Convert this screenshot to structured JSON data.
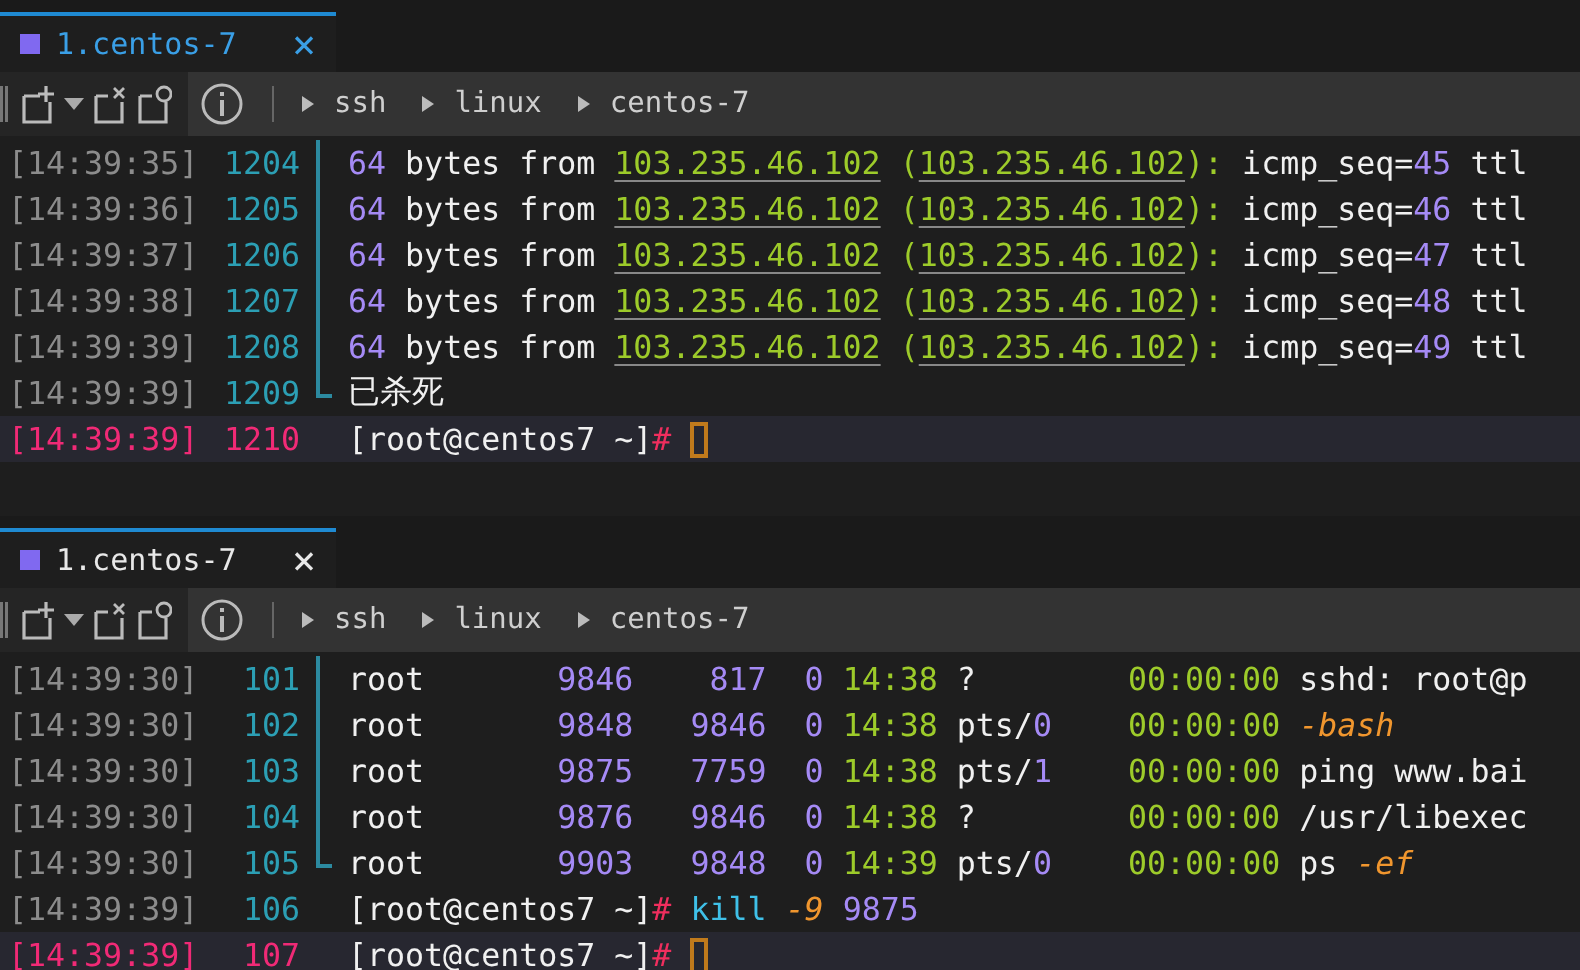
{
  "panes": [
    {
      "active": true,
      "tab": {
        "label": "1.centos-7",
        "close": "×"
      },
      "breadcrumbs": [
        "ssh",
        "linux",
        "centos-7"
      ],
      "lines": [
        {
          "time": "[14:39:35]",
          "number": "1204",
          "current": false,
          "fold_guide": true,
          "fold_end": false,
          "cursor": false,
          "segments": [
            {
              "kind": "number",
              "text": "64"
            },
            {
              "kind": "text",
              "text": " bytes from "
            },
            {
              "kind": "link",
              "text": "103.235.46.102"
            },
            {
              "kind": "time",
              "text": " ("
            },
            {
              "kind": "link",
              "text": "103.235.46.102"
            },
            {
              "kind": "time",
              "text": "):"
            },
            {
              "kind": "text",
              "text": " icmp_seq="
            },
            {
              "kind": "number",
              "text": "45"
            },
            {
              "kind": "text",
              "text": " ttl"
            }
          ]
        },
        {
          "time": "[14:39:36]",
          "number": "1205",
          "current": false,
          "fold_guide": true,
          "fold_end": false,
          "cursor": false,
          "segments": [
            {
              "kind": "number",
              "text": "64"
            },
            {
              "kind": "text",
              "text": " bytes from "
            },
            {
              "kind": "link",
              "text": "103.235.46.102"
            },
            {
              "kind": "time",
              "text": " ("
            },
            {
              "kind": "link",
              "text": "103.235.46.102"
            },
            {
              "kind": "time",
              "text": "):"
            },
            {
              "kind": "text",
              "text": " icmp_seq="
            },
            {
              "kind": "number",
              "text": "46"
            },
            {
              "kind": "text",
              "text": " ttl"
            }
          ]
        },
        {
          "time": "[14:39:37]",
          "number": "1206",
          "current": false,
          "fold_guide": true,
          "fold_end": false,
          "cursor": false,
          "segments": [
            {
              "kind": "number",
              "text": "64"
            },
            {
              "kind": "text",
              "text": " bytes from "
            },
            {
              "kind": "link",
              "text": "103.235.46.102"
            },
            {
              "kind": "time",
              "text": " ("
            },
            {
              "kind": "link",
              "text": "103.235.46.102"
            },
            {
              "kind": "time",
              "text": "):"
            },
            {
              "kind": "text",
              "text": " icmp_seq="
            },
            {
              "kind": "number",
              "text": "47"
            },
            {
              "kind": "text",
              "text": " ttl"
            }
          ]
        },
        {
          "time": "[14:39:38]",
          "number": "1207",
          "current": false,
          "fold_guide": true,
          "fold_end": false,
          "cursor": false,
          "segments": [
            {
              "kind": "number",
              "text": "64"
            },
            {
              "kind": "text",
              "text": " bytes from "
            },
            {
              "kind": "link",
              "text": "103.235.46.102"
            },
            {
              "kind": "time",
              "text": " ("
            },
            {
              "kind": "link",
              "text": "103.235.46.102"
            },
            {
              "kind": "time",
              "text": "):"
            },
            {
              "kind": "text",
              "text": " icmp_seq="
            },
            {
              "kind": "number",
              "text": "48"
            },
            {
              "kind": "text",
              "text": " ttl"
            }
          ]
        },
        {
          "time": "[14:39:39]",
          "number": "1208",
          "current": false,
          "fold_guide": true,
          "fold_end": false,
          "cursor": false,
          "segments": [
            {
              "kind": "number",
              "text": "64"
            },
            {
              "kind": "text",
              "text": " bytes from "
            },
            {
              "kind": "link",
              "text": "103.235.46.102"
            },
            {
              "kind": "time",
              "text": " ("
            },
            {
              "kind": "link",
              "text": "103.235.46.102"
            },
            {
              "kind": "time",
              "text": "):"
            },
            {
              "kind": "text",
              "text": " icmp_seq="
            },
            {
              "kind": "number",
              "text": "49"
            },
            {
              "kind": "text",
              "text": " ttl"
            }
          ]
        },
        {
          "time": "[14:39:39]",
          "number": "1209",
          "current": false,
          "fold_guide": true,
          "fold_end": true,
          "cursor": false,
          "segments": [
            {
              "kind": "text",
              "text": "已杀死"
            }
          ]
        },
        {
          "time": "[14:39:39]",
          "number": "1210",
          "current": true,
          "fold_guide": false,
          "fold_end": false,
          "cursor": true,
          "segments": [
            {
              "kind": "text",
              "text": "[root@centos7 ~]"
            },
            {
              "kind": "hash",
              "text": "# "
            }
          ]
        }
      ]
    },
    {
      "active": false,
      "tab": {
        "label": "1.centos-7",
        "close": "×"
      },
      "breadcrumbs": [
        "ssh",
        "linux",
        "centos-7"
      ],
      "lines": [
        {
          "time": "[14:39:30]",
          "number": "101",
          "current": false,
          "fold_guide": true,
          "fold_end": false,
          "cursor": false,
          "segments": [
            {
              "kind": "text",
              "text": "root       "
            },
            {
              "kind": "number",
              "text": "9846    "
            },
            {
              "kind": "number",
              "text": "817  "
            },
            {
              "kind": "number",
              "text": "0 "
            },
            {
              "kind": "time",
              "text": "14:38"
            },
            {
              "kind": "text",
              "text": " ?        "
            },
            {
              "kind": "time",
              "text": "00:00:00"
            },
            {
              "kind": "text",
              "text": " sshd: root@p"
            }
          ]
        },
        {
          "time": "[14:39:30]",
          "number": "102",
          "current": false,
          "fold_guide": true,
          "fold_end": false,
          "cursor": false,
          "segments": [
            {
              "kind": "text",
              "text": "root       "
            },
            {
              "kind": "number",
              "text": "9848   "
            },
            {
              "kind": "number",
              "text": "9846  "
            },
            {
              "kind": "number",
              "text": "0 "
            },
            {
              "kind": "time",
              "text": "14:38"
            },
            {
              "kind": "text",
              "text": " pts/"
            },
            {
              "kind": "number",
              "text": "0    "
            },
            {
              "kind": "time",
              "text": "00:00:00"
            },
            {
              "kind": "option",
              "text": " -bash"
            }
          ]
        },
        {
          "time": "[14:39:30]",
          "number": "103",
          "current": false,
          "fold_guide": true,
          "fold_end": false,
          "cursor": false,
          "segments": [
            {
              "kind": "text",
              "text": "root       "
            },
            {
              "kind": "number",
              "text": "9875   "
            },
            {
              "kind": "number",
              "text": "7759  "
            },
            {
              "kind": "number",
              "text": "0 "
            },
            {
              "kind": "time",
              "text": "14:38"
            },
            {
              "kind": "text",
              "text": " pts/"
            },
            {
              "kind": "number",
              "text": "1    "
            },
            {
              "kind": "time",
              "text": "00:00:00"
            },
            {
              "kind": "text",
              "text": " ping www.bai"
            }
          ]
        },
        {
          "time": "[14:39:30]",
          "number": "104",
          "current": false,
          "fold_guide": true,
          "fold_end": false,
          "cursor": false,
          "segments": [
            {
              "kind": "text",
              "text": "root       "
            },
            {
              "kind": "number",
              "text": "9876   "
            },
            {
              "kind": "number",
              "text": "9846  "
            },
            {
              "kind": "number",
              "text": "0 "
            },
            {
              "kind": "time",
              "text": "14:38"
            },
            {
              "kind": "text",
              "text": " ?        "
            },
            {
              "kind": "time",
              "text": "00:00:00"
            },
            {
              "kind": "text",
              "text": " /usr/libexec"
            }
          ]
        },
        {
          "time": "[14:39:30]",
          "number": "105",
          "current": false,
          "fold_guide": true,
          "fold_end": true,
          "cursor": false,
          "segments": [
            {
              "kind": "text",
              "text": "root       "
            },
            {
              "kind": "number",
              "text": "9903   "
            },
            {
              "kind": "number",
              "text": "9848  "
            },
            {
              "kind": "number",
              "text": "0 "
            },
            {
              "kind": "time",
              "text": "14:39"
            },
            {
              "kind": "text",
              "text": " pts/"
            },
            {
              "kind": "number",
              "text": "0    "
            },
            {
              "kind": "time",
              "text": "00:00:00"
            },
            {
              "kind": "text",
              "text": " ps "
            },
            {
              "kind": "option",
              "text": "-ef"
            }
          ]
        },
        {
          "time": "[14:39:39]",
          "number": "106",
          "current": false,
          "fold_guide": false,
          "fold_end": false,
          "cursor": false,
          "segments": [
            {
              "kind": "text",
              "text": "[root@centos7 ~]"
            },
            {
              "kind": "hash",
              "text": "# "
            },
            {
              "kind": "command",
              "text": "kill "
            },
            {
              "kind": "option",
              "text": "-9 "
            },
            {
              "kind": "number",
              "text": "9875"
            }
          ]
        },
        {
          "time": "[14:39:39]",
          "number": "107",
          "current": true,
          "fold_guide": false,
          "fold_end": false,
          "cursor": true,
          "segments": [
            {
              "kind": "text",
              "text": "[root@centos7 ~]"
            },
            {
              "kind": "hash",
              "text": "# "
            }
          ]
        }
      ]
    }
  ]
}
